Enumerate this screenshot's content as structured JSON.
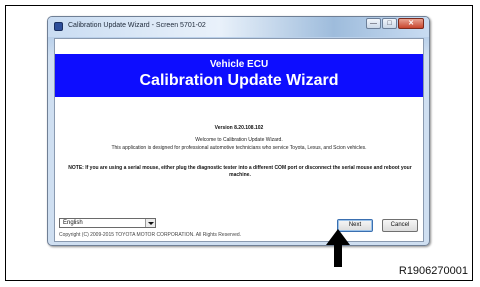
{
  "window": {
    "title": "Calibration Update Wizard - Screen 5701-02",
    "controls": {
      "minimize": "—",
      "maximize": "□",
      "close": "✕"
    }
  },
  "banner": {
    "subtitle": "Vehicle ECU",
    "title": "Calibration Update Wizard"
  },
  "content": {
    "version": "Version 8.20.108.102",
    "welcome": "Welcome to Calibration Update Wizard.",
    "intended_use": "This application is designed for professional automotive technicians who service Toyota, Lexus, and Scion vehicles.",
    "note": "NOTE: If you are using a serial mouse, either plug the diagnostic tester into a different COM port or disconnect the serial mouse and reboot your machine."
  },
  "footer": {
    "language_selected": "English",
    "copyright": "Copyright (C) 2009-2015 TOYOTA MOTOR CORPORATION. All Rights Reserved.",
    "next_label": "Next",
    "cancel_label": "Cancel"
  },
  "figure_id": "R1906270001"
}
